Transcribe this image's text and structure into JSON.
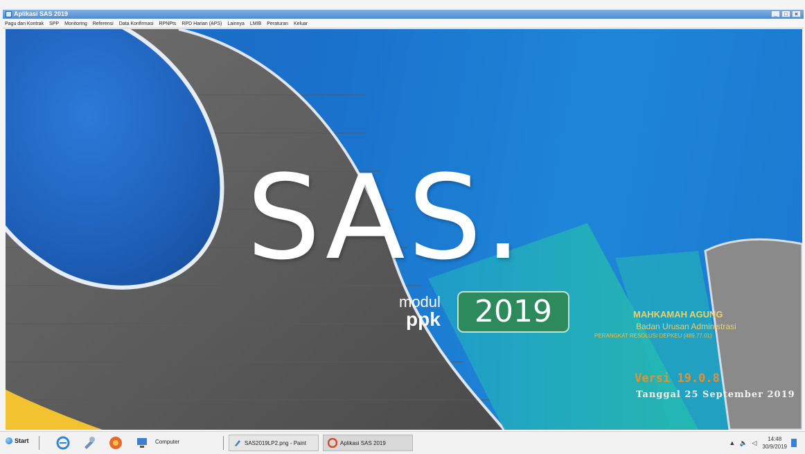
{
  "window": {
    "title": "Aplikasi SAS 2019",
    "controls": [
      "_",
      "□",
      "×"
    ]
  },
  "menubar": {
    "items": [
      "Pagu dan Kontrak",
      "SPP",
      "Monitoring",
      "Referensi",
      "Data Konfirmasi",
      "RPNPts",
      "RPD Harian (APS)",
      "Lainnya",
      "LMIB",
      "Peraturan",
      "Keluar"
    ]
  },
  "splash": {
    "logo_text": "SAS.",
    "modul_text": "modul",
    "ppk_text": "ppk",
    "year": "2019",
    "org_name": "MAHKAMAH AGUNG",
    "org_sub": "Badan Urusan Administrasi",
    "org_line": "PERANGKAT RESOLUSI DEPKEU (489.77.01)",
    "version": "Versi 19.0.8",
    "date_label": "Tanggal 25 September 2019",
    "colors": {
      "background_blue": "#1a72cc",
      "badge_green": "#2d8a5c",
      "org_gold": "#f0d060",
      "version_orange": "#e8902c"
    }
  },
  "taskbar": {
    "start_label": "Start",
    "icons": [
      "ie-icon",
      "tools-icon",
      "media-icon",
      "computer-icon"
    ],
    "computer_label": "Computer",
    "tasks": [
      {
        "label": "SAS2019LP2.png - Paint",
        "icon": "paint-icon"
      },
      {
        "label": "Aplikasi SAS 2019",
        "icon": "sas-icon",
        "active": true
      }
    ],
    "tray_glyphs": "▲ 🔈 ◁",
    "time": "14:48",
    "date": "30/9/2019"
  }
}
